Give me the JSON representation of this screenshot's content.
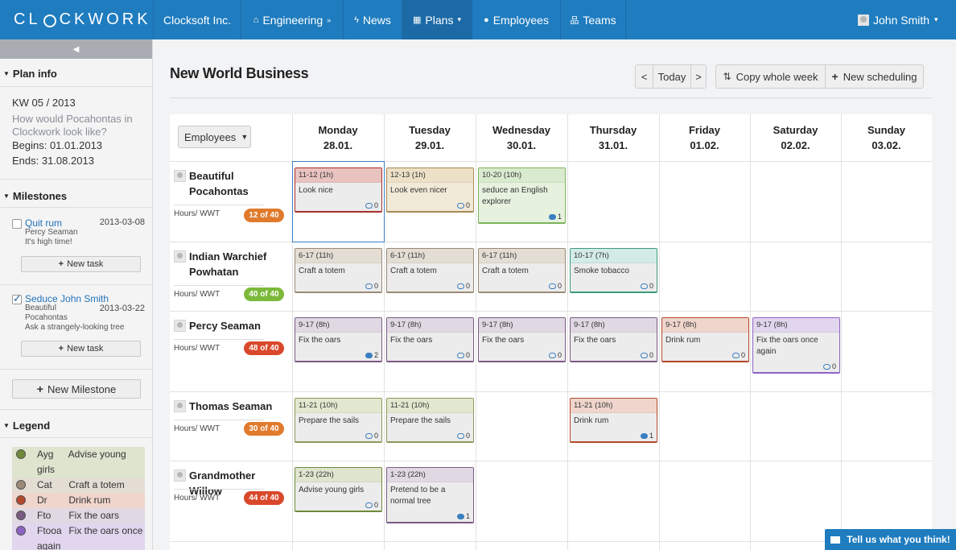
{
  "nav": {
    "logo_a": "CL",
    "logo_b": "CKWORK",
    "items": [
      {
        "label": "Clocksoft Inc.",
        "icon": "",
        "caret": ""
      },
      {
        "label": "Engineering",
        "icon": "home-icon",
        "caret": "»"
      },
      {
        "label": "News",
        "icon": "bolt-icon",
        "caret": ""
      },
      {
        "label": "Plans",
        "icon": "calendar-icon",
        "caret": "▾"
      },
      {
        "label": "Employees",
        "icon": "user-icon",
        "caret": ""
      },
      {
        "label": "Teams",
        "icon": "sitemap-icon",
        "caret": ""
      }
    ],
    "user": "John Smith",
    "user_caret": "▾"
  },
  "sidebar": {
    "collapse": "◀",
    "plan_info": {
      "heading": "Plan info",
      "kw": "KW 05 / 2013",
      "question": "How would Pocahontas in Clockwork look like?",
      "begins": "Begins: 01.01.2013",
      "ends": "Ends: 31.08.2013"
    },
    "milestones": {
      "heading": "Milestones",
      "items": [
        {
          "title": "Quit rum",
          "date": "2013-03-08",
          "who": "Percy Seaman",
          "note": "It's high time!",
          "checked": false,
          "new_task": "New task"
        },
        {
          "title": "Seduce John Smith",
          "date": "2013-03-22",
          "who": "Beautiful Pocahontas",
          "note": "Ask a strangely-looking tree",
          "checked": true,
          "new_task": "New task"
        }
      ],
      "new_milestone": "New Milestone"
    },
    "legend": {
      "heading": "Legend",
      "items": [
        {
          "abbr": "Ayg",
          "label": "Advise young girls",
          "bg": "#dfe4cf",
          "dot": "#6f8a3a"
        },
        {
          "abbr": "Cat",
          "label": "Craft a totem",
          "bg": "#e3ddd3",
          "dot": "#9a8a76"
        },
        {
          "abbr": "Dr",
          "label": "Drink rum",
          "bg": "#efd5cc",
          "dot": "#b5482b"
        },
        {
          "abbr": "Fto",
          "label": "Fix the oars",
          "bg": "#e0d8e2",
          "dot": "#7b5a84"
        },
        {
          "abbr": "Ftooa",
          "label": "Fix the oars once again",
          "bg": "#e1d6ee",
          "dot": "#8e63c4"
        }
      ]
    }
  },
  "main": {
    "title": "New World Business",
    "prev": "<",
    "today": "Today",
    "next": ">",
    "copy_week": "Copy whole week",
    "new_scheduling": "New scheduling",
    "employees_select": "Employees",
    "days": [
      {
        "name": "Monday",
        "date": "28.01."
      },
      {
        "name": "Tuesday",
        "date": "29.01."
      },
      {
        "name": "Wednesday",
        "date": "30.01."
      },
      {
        "name": "Thursday",
        "date": "31.01."
      },
      {
        "name": "Friday",
        "date": "01.02."
      },
      {
        "name": "Saturday",
        "date": "02.02."
      },
      {
        "name": "Sunday",
        "date": "03.02."
      }
    ],
    "hours_label": "Hours/ WWT",
    "employees": [
      {
        "name": "Beautiful Pocahontas",
        "badge": "12 of 40",
        "badge_color": "#e07a2c"
      },
      {
        "name": "Indian Warchief Powhatan",
        "badge": "40 of 40",
        "badge_color": "#7cb93a"
      },
      {
        "name": "Percy Seaman",
        "badge": "48 of 40",
        "badge_color": "#d9482b"
      },
      {
        "name": "Thomas Seaman",
        "badge": "30 of 40",
        "badge_color": "#e07a2c"
      },
      {
        "name": "Grandmother Willow",
        "badge": "44 of 40",
        "badge_color": "#d9482b"
      }
    ],
    "shifts": [
      {
        "row": 0,
        "day": 0,
        "time": "11-12 (1h)",
        "desc": "Look nice",
        "comments": "0",
        "filled": false,
        "border": "#a8302a",
        "top": "#e9c3c0",
        "bg": "#ececec"
      },
      {
        "row": 0,
        "day": 1,
        "time": "12-13 (1h)",
        "desc": "Look even nicer",
        "comments": "0",
        "filled": false,
        "border": "#a88a55",
        "top": "#ece0c6",
        "bg": "#f1ead8"
      },
      {
        "row": 0,
        "day": 2,
        "time": "10-20 (10h)",
        "desc": "seduce an English explorer",
        "comments": "1",
        "filled": true,
        "border": "#7cb35a",
        "top": "#d9ebcf",
        "bg": "#e6f1de"
      },
      {
        "row": 1,
        "day": 0,
        "time": "6-17 (11h)",
        "desc": "Craft a totem",
        "comments": "0",
        "filled": false,
        "border": "#9a8a76",
        "top": "#e3ddd3",
        "bg": "#ececec"
      },
      {
        "row": 1,
        "day": 1,
        "time": "6-17 (11h)",
        "desc": "Craft a totem",
        "comments": "0",
        "filled": false,
        "border": "#9a8a76",
        "top": "#e3ddd3",
        "bg": "#ececec"
      },
      {
        "row": 1,
        "day": 2,
        "time": "6-17 (11h)",
        "desc": "Craft a totem",
        "comments": "0",
        "filled": false,
        "border": "#9a8a76",
        "top": "#e3ddd3",
        "bg": "#ececec"
      },
      {
        "row": 1,
        "day": 3,
        "time": "10-17 (7h)",
        "desc": "Smoke tobacco",
        "comments": "0",
        "filled": false,
        "border": "#3f9a80",
        "top": "#d2ebe4",
        "bg": "#ececec"
      },
      {
        "row": 2,
        "day": 0,
        "time": "9-17 (8h)",
        "desc": "Fix the oars",
        "comments": "2",
        "filled": true,
        "border": "#7b5a84",
        "top": "#e0d8e2",
        "bg": "#ececec"
      },
      {
        "row": 2,
        "day": 1,
        "time": "9-17 (8h)",
        "desc": "Fix the oars",
        "comments": "0",
        "filled": false,
        "border": "#7b5a84",
        "top": "#e0d8e2",
        "bg": "#ececec"
      },
      {
        "row": 2,
        "day": 2,
        "time": "9-17 (8h)",
        "desc": "Fix the oars",
        "comments": "0",
        "filled": false,
        "border": "#7b5a84",
        "top": "#e0d8e2",
        "bg": "#ececec"
      },
      {
        "row": 2,
        "day": 3,
        "time": "9-17 (8h)",
        "desc": "Fix the oars",
        "comments": "0",
        "filled": false,
        "border": "#7b5a84",
        "top": "#e0d8e2",
        "bg": "#ececec"
      },
      {
        "row": 2,
        "day": 4,
        "time": "9-17 (8h)",
        "desc": "Drink rum",
        "comments": "0",
        "filled": false,
        "border": "#b5482b",
        "top": "#efd5cc",
        "bg": "#ececec"
      },
      {
        "row": 2,
        "day": 5,
        "time": "9-17 (8h)",
        "desc": "Fix the oars once again",
        "comments": "0",
        "filled": false,
        "border": "#8e63c4",
        "top": "#e1d6ee",
        "bg": "#ececec"
      },
      {
        "row": 3,
        "day": 0,
        "time": "11-21 (10h)",
        "desc": "Prepare the sails",
        "comments": "0",
        "filled": false,
        "border": "#8a9a5a",
        "top": "#e2e8cf",
        "bg": "#ececec"
      },
      {
        "row": 3,
        "day": 1,
        "time": "11-21 (10h)",
        "desc": "Prepare the sails",
        "comments": "0",
        "filled": false,
        "border": "#8a9a5a",
        "top": "#e2e8cf",
        "bg": "#ececec"
      },
      {
        "row": 3,
        "day": 3,
        "time": "11-21 (10h)",
        "desc": "Drink rum",
        "comments": "1",
        "filled": true,
        "border": "#b5482b",
        "top": "#efd5cc",
        "bg": "#ececec"
      },
      {
        "row": 4,
        "day": 0,
        "time": "1-23 (22h)",
        "desc": "Advise young girls",
        "comments": "0",
        "filled": false,
        "border": "#6f8a3a",
        "top": "#dfe4cf",
        "bg": "#ececec"
      },
      {
        "row": 4,
        "day": 1,
        "time": "1-23 (22h)",
        "desc": "Pretend to be a normal tree",
        "comments": "1",
        "filled": true,
        "border": "#7b5a84",
        "top": "#e0d8e2",
        "bg": "#ececec"
      }
    ]
  },
  "feedback": "Tell us what you think!"
}
